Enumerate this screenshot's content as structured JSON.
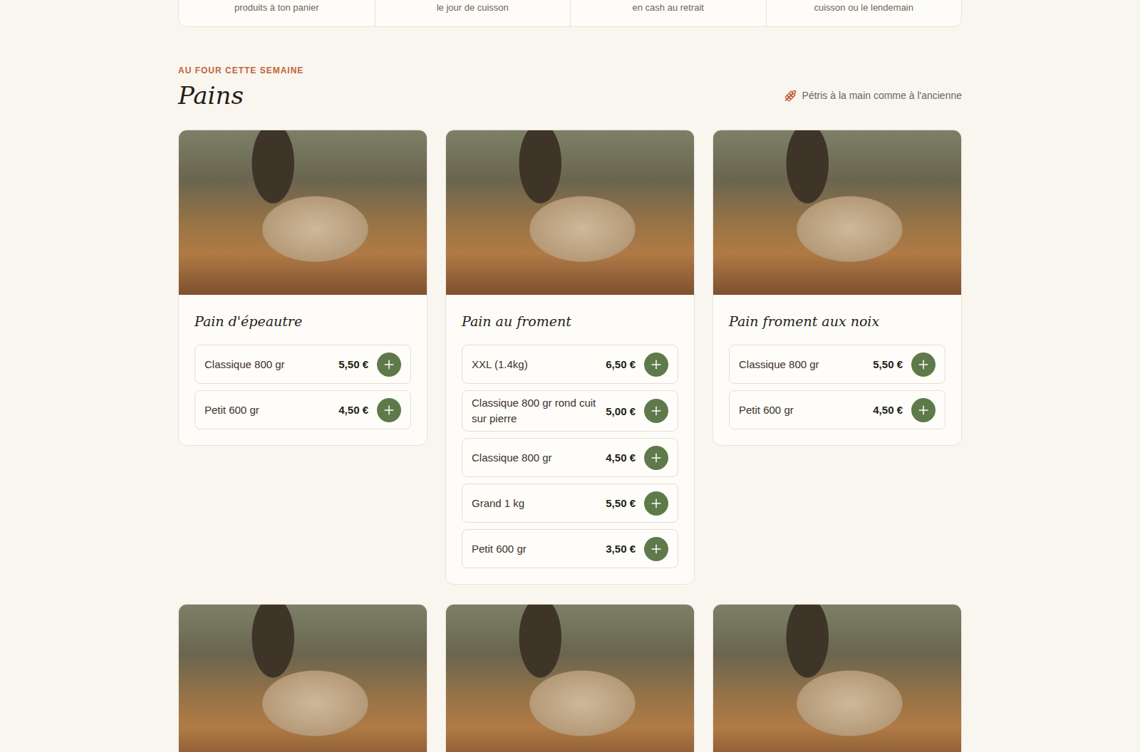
{
  "features": [
    "produits à ton panier",
    "le jour de cuisson",
    "en cash au retrait",
    "cuisson ou le lendemain"
  ],
  "section": {
    "eyebrow": "AU FOUR CETTE SEMAINE",
    "title": "Pains",
    "note": "Pétris à la main comme à l'ancienne"
  },
  "products": [
    {
      "name": "Pain d'épeautre",
      "options": [
        {
          "label": "Classique 800 gr",
          "price": "5,50 €"
        },
        {
          "label": "Petit 600 gr",
          "price": "4,50 €"
        }
      ]
    },
    {
      "name": "Pain au froment",
      "options": [
        {
          "label": "XXL (1.4kg)",
          "price": "6,50 €"
        },
        {
          "label": "Classique 800 gr rond cuit sur pierre",
          "price": "5,00 €"
        },
        {
          "label": "Classique 800 gr",
          "price": "4,50 €"
        },
        {
          "label": "Grand 1 kg",
          "price": "5,50 €"
        },
        {
          "label": "Petit 600 gr",
          "price": "3,50 €"
        }
      ]
    },
    {
      "name": "Pain froment aux noix",
      "options": [
        {
          "label": "Classique 800 gr",
          "price": "5,50 €"
        },
        {
          "label": "Petit 600 gr",
          "price": "4,50 €"
        }
      ]
    },
    {
      "options": []
    },
    {
      "options": []
    },
    {
      "options": []
    }
  ]
}
